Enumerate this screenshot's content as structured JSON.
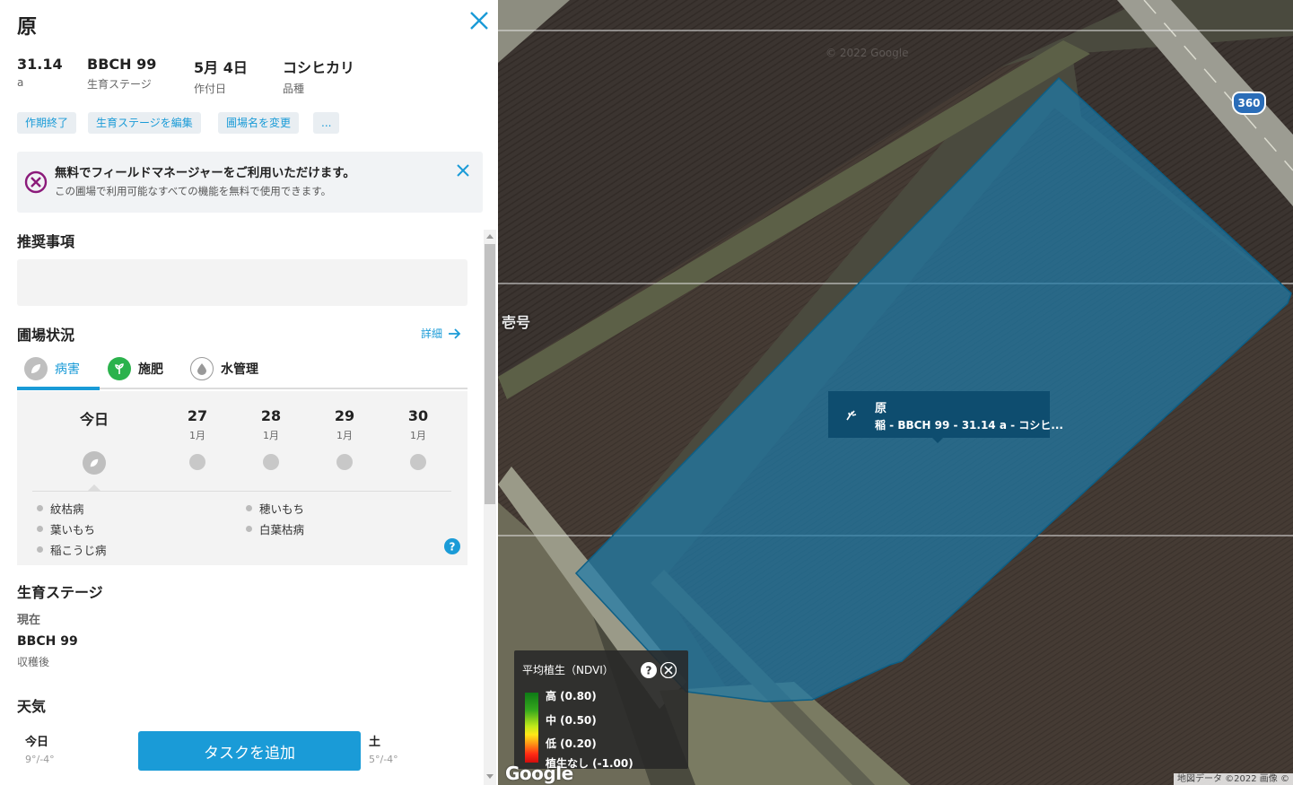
{
  "panel": {
    "title": "原",
    "stats": [
      {
        "value": "31.14",
        "label": "a"
      },
      {
        "value": "BBCH 99",
        "label": "生育ステージ"
      },
      {
        "value": "5月 4日",
        "label": "作付日"
      },
      {
        "value": "コシヒカリ",
        "label": "品種"
      }
    ],
    "actions": [
      "作期終了",
      "生育ステージを編集",
      "圃場名を変更",
      "..."
    ],
    "promo": {
      "title": "無料でフィールドマネージャーをご利用いただけます。",
      "subtitle": "この圃場で利用可能なすべての機能を無料で使用できます。"
    },
    "recommendations_title": "推奨事項",
    "field_status": {
      "title": "圃場状況",
      "detail_link": "詳細",
      "tabs": [
        "病害",
        "施肥",
        "水管理"
      ],
      "days": [
        {
          "day": "今日",
          "month": ""
        },
        {
          "day": "27",
          "month": "1月"
        },
        {
          "day": "28",
          "month": "1月"
        },
        {
          "day": "29",
          "month": "1月"
        },
        {
          "day": "30",
          "month": "1月"
        }
      ],
      "diseases_left": [
        "紋枯病",
        "葉いもち",
        "稲こうじ病"
      ],
      "diseases_right": [
        "穂いもち",
        "白葉枯病"
      ]
    },
    "growth_stage": {
      "title": "生育ステージ",
      "current_label": "現在",
      "value": "BBCH 99",
      "desc": "収穫後"
    },
    "weather": {
      "title": "天気",
      "left": {
        "day": "今日",
        "temp": "9°/-4°"
      },
      "right": {
        "day": "土",
        "temp": "5°/-4°"
      }
    },
    "add_task": "タスクを追加"
  },
  "map": {
    "road_number": "360",
    "place_label": "壱号",
    "watermark": "© 2022 Google",
    "tooltip": {
      "title": "原",
      "subtitle": "稲 - BBCH 99 - 31.14 a - コシヒ..."
    },
    "legend": {
      "title": "平均植生（NDVI）",
      "items": [
        "高 (0.80)",
        "中 (0.50)",
        "低 (0.20)",
        "植生なし (-1.00)"
      ]
    },
    "google_logo": "Google",
    "attribution": "地図データ ©2022 画像 ©"
  },
  "colors": {
    "accent": "#1a9bd7",
    "green": "#2bb24c",
    "field_fill": "#1f6f95",
    "tooltip_bg": "#0e4d6f"
  }
}
